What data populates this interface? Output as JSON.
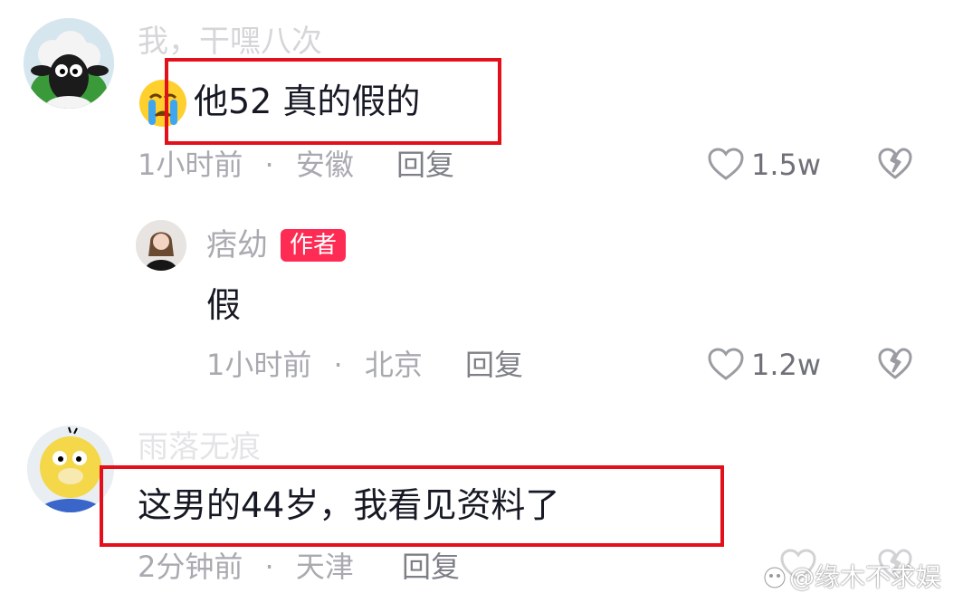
{
  "comments": [
    {
      "username": "我，干嘿八次",
      "content": "他52 真的假的",
      "emoji": "😭",
      "time": "1小时前",
      "location": "安徽",
      "reply_label": "回复",
      "likes": "1.5w",
      "avatar_icon": "sheep-avatar"
    },
    {
      "username": "痞幼",
      "badge": "作者",
      "content": "假",
      "time": "1小时前",
      "location": "北京",
      "reply_label": "回复",
      "likes": "1.2w",
      "avatar_icon": "woman-avatar"
    },
    {
      "username": "雨落无痕",
      "content": "这男的44岁，我看见资料了",
      "time": "2分钟前",
      "location": "天津",
      "reply_label": "回复",
      "avatar_icon": "duck-avatar"
    }
  ],
  "separator": "·",
  "watermark": "@缘木不求娱",
  "colors": {
    "highlight_box": "#e3101b",
    "author_badge": "#fe2c55"
  }
}
